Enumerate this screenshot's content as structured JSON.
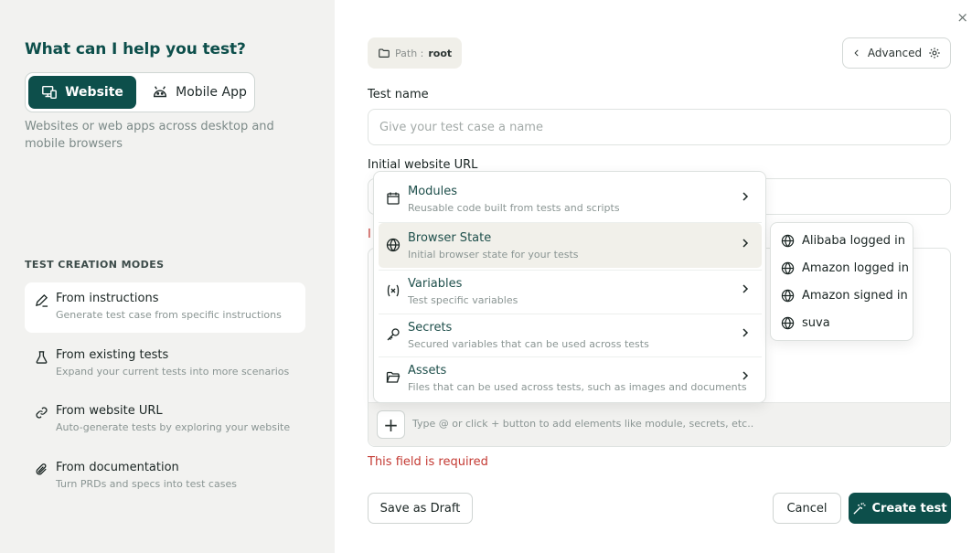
{
  "left": {
    "title": "What can I help you test?",
    "segments": [
      {
        "label": "Website",
        "active": true,
        "icon": "devices-icon"
      },
      {
        "label": "Mobile App",
        "active": false,
        "icon": "android-icon"
      }
    ],
    "description": "Websites or web apps across desktop and mobile browsers",
    "modes_title": "TEST CREATION MODES",
    "modes": [
      {
        "title": "From instructions",
        "desc": "Generate test case from specific instructions",
        "icon": "pencil-icon",
        "selected": true
      },
      {
        "title": "From existing tests",
        "desc": "Expand your current tests into more scenarios",
        "icon": "flask-icon",
        "selected": false
      },
      {
        "title": "From website URL",
        "desc": "Auto-generate tests by exploring your website",
        "icon": "link-icon",
        "selected": false
      },
      {
        "title": "From documentation",
        "desc": "Turn PRDs and specs into test cases",
        "icon": "paperclip-icon",
        "selected": false
      }
    ]
  },
  "header": {
    "path_label": "Path :",
    "path_value": "root",
    "advanced_label": "Advanced",
    "close_glyph": "×"
  },
  "form": {
    "test_name_label": "Test name",
    "test_name_placeholder": "Give your test case a name",
    "url_label": "Initial website URL",
    "error_peek": "I",
    "editor_hint": "Type @ or click + button to add elements like module, secrets, etc..",
    "plus_glyph": "+",
    "required_error": "This field is required"
  },
  "menu": {
    "items": [
      {
        "title": "Modules",
        "desc": "Reusable code built from tests and scripts",
        "icon": "calendar-module-icon",
        "highlighted": false
      },
      {
        "title": "Browser State",
        "desc": "Initial browser state for your tests",
        "icon": "globe-icon",
        "highlighted": true
      },
      {
        "title": "Variables",
        "desc": "Test specific variables",
        "icon": "variable-icon",
        "highlighted": false
      },
      {
        "title": "Secrets",
        "desc": "Secured variables that can be used across tests",
        "icon": "key-icon",
        "highlighted": false
      },
      {
        "title": "Assets",
        "desc": "Files that can be used across tests, such as images and documents",
        "icon": "folder-open-icon",
        "highlighted": false
      }
    ]
  },
  "submenu": {
    "items": [
      "Alibaba logged in",
      "Amazon logged in",
      "Amazon signed in",
      "suva"
    ]
  },
  "footer": {
    "draft_label": "Save as Draft",
    "cancel_label": "Cancel",
    "create_label": "Create test"
  },
  "colors": {
    "brand": "#0d4f4b",
    "error": "#c43a33",
    "panel": "#f2f2f0"
  }
}
